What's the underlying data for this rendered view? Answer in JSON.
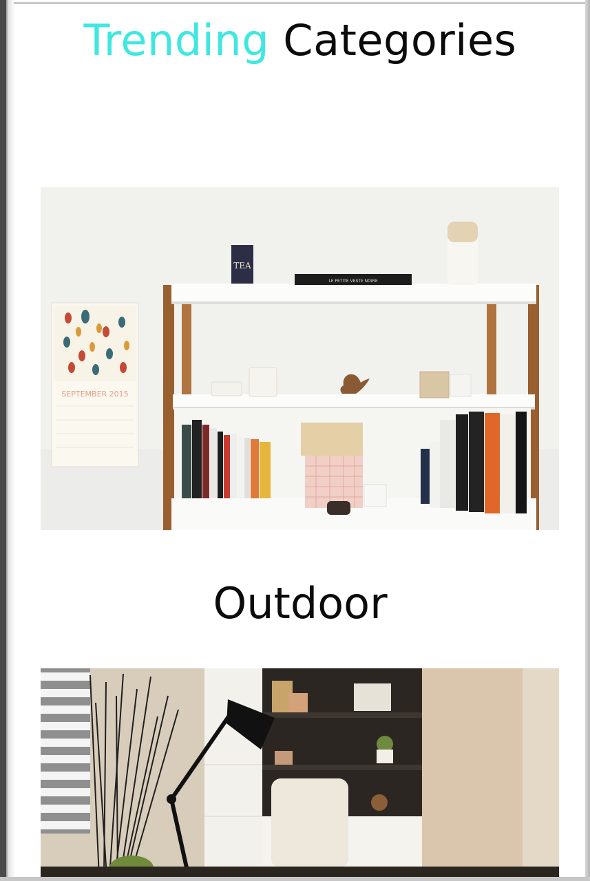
{
  "heading": {
    "accent_word": "Trending",
    "main_word": "Categories"
  },
  "categories": [
    {
      "label": "Outdoor",
      "image": "bookshelf-photo"
    },
    {
      "label": "",
      "image": "desk-lamp-office-photo"
    }
  ],
  "photo_text": {
    "calendar_month": "SEPTEMBER 2015",
    "tea_box": "TEA",
    "book_spine": "LE PETITE VESTE NOIRE"
  },
  "colors": {
    "accent": "#3ee8e0",
    "text": "#0b0b0b"
  }
}
